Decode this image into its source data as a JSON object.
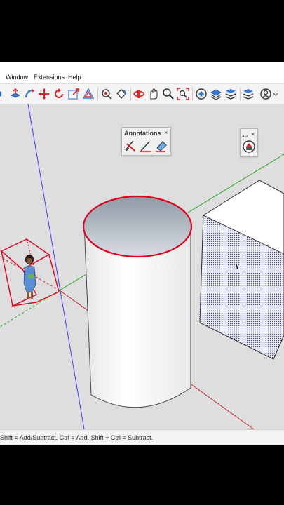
{
  "menu": {
    "items": [
      {
        "label": "Window"
      },
      {
        "label": "Extensions"
      },
      {
        "label": "Help"
      }
    ]
  },
  "toolbar": {
    "icons": [
      "move-icon",
      "rotate-icon",
      "scale-icon",
      "orbit-icon",
      "pan-icon",
      "zoom-icon",
      "section-plane-icon",
      "sandbox-icon",
      "profile-icon"
    ]
  },
  "annotations_panel": {
    "title": "Annotations",
    "close": "×",
    "tools": [
      "text-annotation-icon",
      "line-annotation-icon",
      "erase-annotation-icon"
    ]
  },
  "mini_panel": {
    "title": "...",
    "close": "×"
  },
  "status": {
    "text": "Shift = Add/Subtract. Ctrl = Add. Shift + Ctrl = Subtract."
  },
  "colors": {
    "selection": "#e0001b",
    "axis_red": "#cc2b2b",
    "axis_green": "#1faa1f",
    "axis_blue": "#3a3aff",
    "viewport": "#dedede"
  }
}
